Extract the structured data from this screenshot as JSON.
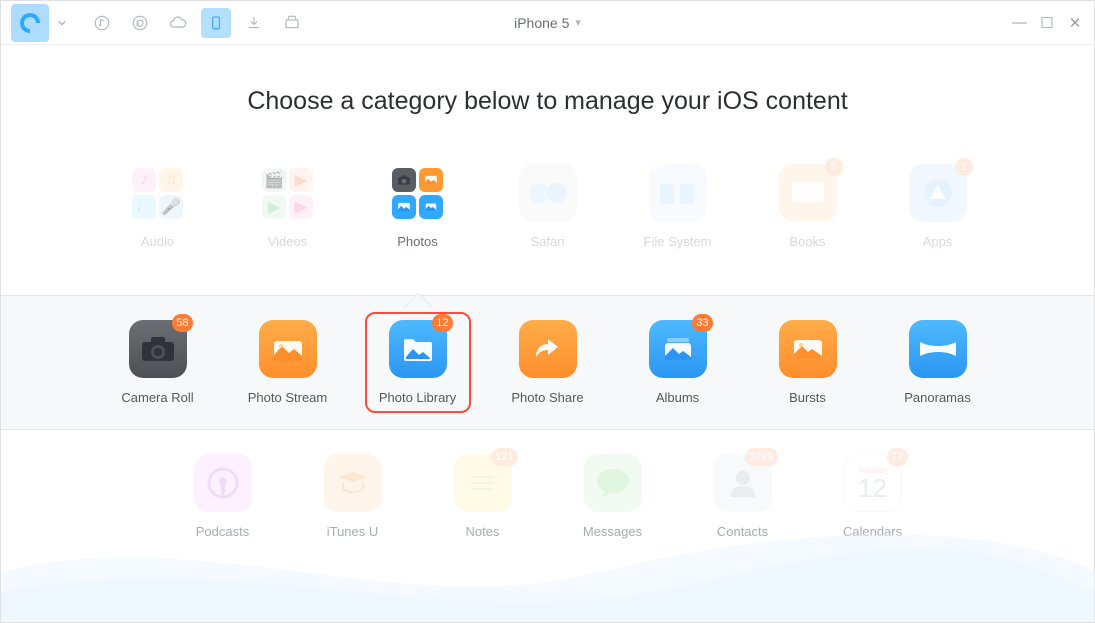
{
  "titlebar": {
    "device": "iPhone 5"
  },
  "heading": "Choose a category below to manage your iOS content",
  "categories": [
    {
      "label": "Audio"
    },
    {
      "label": "Videos"
    },
    {
      "label": "Photos"
    },
    {
      "label": "Safari"
    },
    {
      "label": "File System"
    },
    {
      "label": "Books",
      "badge": "5"
    },
    {
      "label": "Apps",
      "badge": "1"
    }
  ],
  "sub_categories": [
    {
      "label": "Camera Roll",
      "badge": "58"
    },
    {
      "label": "Photo Stream"
    },
    {
      "label": "Photo Library",
      "badge": "12",
      "selected": true
    },
    {
      "label": "Photo Share"
    },
    {
      "label": "Albums",
      "badge": "33"
    },
    {
      "label": "Bursts"
    },
    {
      "label": "Panoramas"
    }
  ],
  "bottom_categories": [
    {
      "label": "Podcasts"
    },
    {
      "label": "iTunes U"
    },
    {
      "label": "Notes",
      "badge": "121"
    },
    {
      "label": "Messages"
    },
    {
      "label": "Contacts",
      "badge": "2299"
    },
    {
      "label": "Calendars",
      "badge": "77",
      "day": "Tuesday",
      "num": "12"
    }
  ]
}
